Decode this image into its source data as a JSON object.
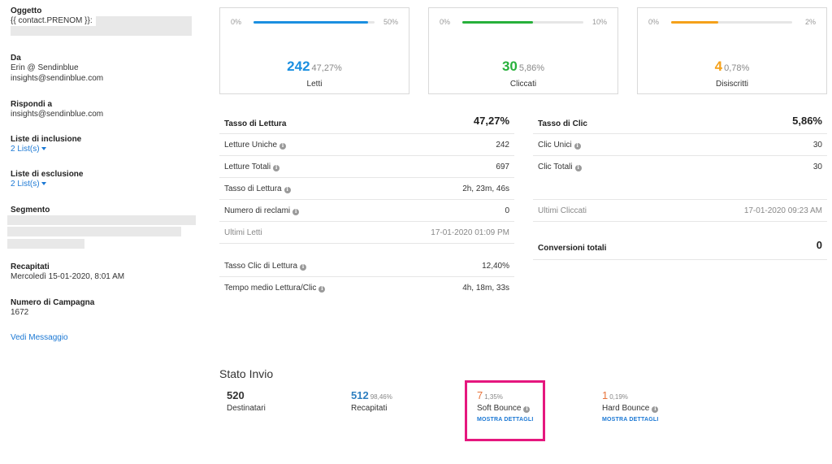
{
  "left": {
    "oggetto_label": "Oggetto",
    "oggetto_value": "{{ contact.PRENOM }}:",
    "da_label": "Da",
    "da_name": "Erin @ Sendinblue",
    "da_email": "insights@sendinblue.com",
    "rispondi_label": "Rispondi a",
    "rispondi_email": "insights@sendinblue.com",
    "inclusione_label": "Liste di inclusione",
    "inclusione_value": "2 List(s)",
    "esclusione_label": "Liste di esclusione",
    "esclusione_value": "2 List(s)",
    "segmento_label": "Segmento",
    "recapitati_label": "Recapitati",
    "recapitati_value": "Mercoledì 15-01-2020, 8:01 AM",
    "numero_label": "Numero di Campagna",
    "numero_value": "1672",
    "vedi_link": "Vedi Messaggio"
  },
  "cards": [
    {
      "min": "0%",
      "max": "50%",
      "fill_fraction": 0.945,
      "color": "#1b8fe0",
      "number": "242",
      "pct": "47,27%",
      "label": "Letti"
    },
    {
      "min": "0%",
      "max": "10%",
      "fill_fraction": 0.586,
      "color": "#27b03b",
      "number": "30",
      "pct": "5,86%",
      "label": "Cliccati"
    },
    {
      "min": "0%",
      "max": "2%",
      "fill_fraction": 0.39,
      "color": "#f5a11a",
      "number": "4",
      "pct": "0,78%",
      "label": "Disiscritti"
    }
  ],
  "lettura": {
    "title": "Tasso di Lettura",
    "title_value": "47,27%",
    "rows": [
      {
        "k": "Letture Uniche",
        "v": "242",
        "info": true
      },
      {
        "k": "Letture Totali",
        "v": "697",
        "info": true
      },
      {
        "k": "Tasso di Lettura",
        "v": "2h, 23m, 46s",
        "info": true
      },
      {
        "k": "Numero di reclami",
        "v": "0",
        "info": true
      },
      {
        "k": "Ultimi Letti",
        "v": "17-01-2020 01:09 PM",
        "info": false
      }
    ],
    "extra_rows": [
      {
        "k": "Tasso Clic di Lettura",
        "v": "12,40%",
        "info": true
      },
      {
        "k": "Tempo medio Lettura/Clic",
        "v": "4h, 18m, 33s",
        "info": true
      }
    ]
  },
  "clic": {
    "title": "Tasso di Clic",
    "title_value": "5,86%",
    "rows": [
      {
        "k": "Clic Unici",
        "v": "30",
        "info": true
      },
      {
        "k": "Clic Totali",
        "v": "30",
        "info": true
      }
    ],
    "ultimi_k": "Ultimi Cliccati",
    "ultimi_v": "17-01-2020 09:23 AM",
    "conversioni_k": "Conversioni totali",
    "conversioni_v": "0"
  },
  "stato": {
    "title": "Stato Invio",
    "destinatari_n": "520",
    "destinatari_t": "Destinatari",
    "recapitati_n": "512",
    "recapitati_p": "98,46%",
    "recapitati_t": "Recapitati",
    "soft_n": "7",
    "soft_p": "1,35%",
    "soft_t": "Soft Bounce",
    "soft_md": "MOSTRA DETTAGLI",
    "hard_n": "1",
    "hard_p": "0,19%",
    "hard_t": "Hard Bounce",
    "hard_md": "MOSTRA DETTAGLI"
  },
  "colors": {
    "blue_num": "#1b8fe0",
    "green_num": "#27b03b",
    "orange_num": "#f5a11a",
    "dark_num": "#333333",
    "stato_blue": "#2e7fc0",
    "stato_orange": "#e8743b",
    "highlight": "#e5177e"
  }
}
